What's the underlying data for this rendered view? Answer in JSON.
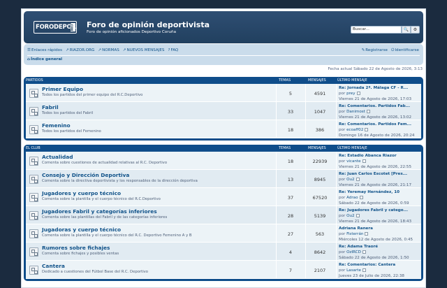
{
  "header": {
    "logo_text": "FORODEPOR",
    "logo_suffix": ".COM",
    "site_title": "Foro de opinión deportivista",
    "site_description": "Foro de opinión aficionados Deportivo Coruña",
    "search_placeholder": "Buscar...",
    "search_button": "🔍",
    "advanced_search_button": "⚙"
  },
  "nav": {
    "quick_links": "Enlaces rápidos",
    "riazor": "RIAZOR.ORG",
    "normas": "NORMAS",
    "nuevos": "NUEVOS MENSAJES",
    "faq": "FAQ",
    "register": "Registrarse",
    "login": "Identificarse",
    "index": "Índice general"
  },
  "time_info": "Fecha actual Sábado 22 de Agosto de 2026, 3:13",
  "columns": {
    "topics": "TEMAS",
    "posts": "MENSAJES",
    "last_post": "ÚLTIMO MENSAJE"
  },
  "categories": [
    {
      "name": "PARTIDOS",
      "forums": [
        {
          "title": "Primer Equipo",
          "desc": "Todos los partidos del primer equipo del R.C.Deportivo",
          "topics": "5",
          "posts": "4591",
          "last_title": "Re: Jornada 2ª. Málaga CF - R...",
          "last_by_prefix": "por",
          "last_author": "prey",
          "last_date": "Viernes 21 de Agosto de 2026, 17:03"
        },
        {
          "title": "Fabril",
          "desc": "Todos los partidos del Fabril",
          "topics": "33",
          "posts": "1047",
          "last_title": "Re: Comentarios. Partidos Fab...",
          "last_by_prefix": "por",
          "last_author": "Danimost",
          "last_date": "Viernes 21 de Agosto de 2026, 13:02"
        },
        {
          "title": "Femenino",
          "desc": "Todos los partidos del Femenino",
          "topics": "18",
          "posts": "386",
          "last_title": "Re: Comentarios. Partidos Fem...",
          "last_by_prefix": "por",
          "last_author": "ecoaff02",
          "last_date": "Domingo 16 de Agosto de 2026, 20:24"
        }
      ]
    },
    {
      "name": "EL CLUB",
      "forums": [
        {
          "title": "Actualidad",
          "desc": "Comenta sobre cuestiones de actualidad relativas al R.C. Deportivo",
          "topics": "18",
          "posts": "22939",
          "last_title": "Re: Estadio Abanca Riazor",
          "last_by_prefix": "por",
          "last_author": "vicante",
          "last_date": "Viernes 21 de Agosto de 2026, 22:55"
        },
        {
          "title": "Consejo y Dirección Deportiva",
          "desc": "Comenta sobre la directiva deportivista y los responsables de la dirección deportiva",
          "topics": "13",
          "posts": "8945",
          "last_title": "Re: Juan Carlos Escotet [Pres...",
          "last_by_prefix": "por",
          "last_author": "Ou2",
          "last_date": "Viernes 21 de Agosto de 2026, 21:17"
        },
        {
          "title": "Jugadores y cuerpo técnico",
          "desc": "Comenta sobre la plantilla y el cuerpo técnico del R.C.Deportivo",
          "topics": "37",
          "posts": "67520",
          "last_title": "Re: Yeremay Hernández, 10",
          "last_by_prefix": "por",
          "last_author": "Adrao",
          "last_date": "Sábado 22 de Agosto de 2026, 0:59"
        },
        {
          "title": "Jugadores Fabril y categorías inferiores",
          "desc": "Comenta sobre las plantillas del Fabril y de las categorías inferiores",
          "topics": "28",
          "posts": "5139",
          "last_title": "Re: Jugadores Fabril y catego...",
          "last_by_prefix": "por",
          "last_author": "Ou2",
          "last_date": "Viernes 21 de Agosto de 2026, 18:43"
        },
        {
          "title": "Jugadoras y cuerpo técnico",
          "desc": "Comenta sobre la plantilla y el cuerpo técnico del R.C. Deportivo Femenino A y B",
          "topics": "27",
          "posts": "563",
          "last_title": "Adriana Ranera",
          "last_by_prefix": "por",
          "last_author": "Fisterrán",
          "last_date": "Miércoles 12 de Agosto de 2026, 0:45"
        },
        {
          "title": "Rumores sobre fichajes",
          "desc": "Comenta sobre fichajes y posibles ventas",
          "topics": "4",
          "posts": "8642",
          "last_title": "Re: Adama Traoré",
          "last_by_prefix": "por",
          "last_author": "OzIRCD",
          "last_date": "Sábado 22 de Agosto de 2026, 1:50"
        },
        {
          "title": "Cantera",
          "desc": "Dedicado a cuestiones del Fútbol Base del R.C. Deportivo",
          "topics": "7",
          "posts": "2107",
          "last_title": "Re: Comentarios: Cantera",
          "last_by_prefix": "por",
          "last_author": "Lasarte",
          "last_date": "Jueves 23 de Julio de 2026, 22:38"
        }
      ]
    }
  ]
}
